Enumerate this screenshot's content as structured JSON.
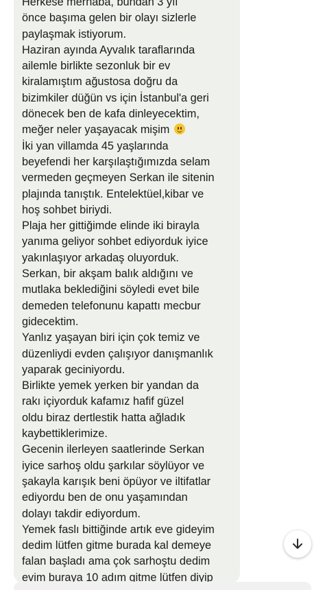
{
  "message": {
    "lines": [
      "Herkese merhaba, bundan 3 yıl",
      "önce başıma gelen bir olayı sizlerle",
      "paylaşmak istiyorum.",
      "Haziran ayında Ayvalık taraflarında",
      "ailemle birlikte sezonluk bir ev",
      "kiralamıştım ağustosa doğru da",
      "bizimkiler düğün vs için İstanbul'a geri",
      "dönecek ben de kafa dinleyecektim,",
      "meğer neler yaşayacak mişim",
      "İki yan villamda 45 yaşlarında",
      "beyefendi her karşılaştığımızda selam",
      "vermeden geçmeyen Serkan ile sitenin",
      "plajında tanıştık. Entelektüel,kibar ve",
      "hoş sohbet biriydi.",
      "Plaja her gittiğimde elinde iki birayla",
      "yanıma geliyor sohbet ediyorduk iyice",
      "yakınlaşıyor arkadaş oluyorduk.",
      "Serkan, bir akşam balık aldığını ve",
      "mutlaka beklediğini söyledi evet bile",
      "demeden telefonunu kapattı mecbur",
      "gidecektim.",
      "Yanlız yaşayan biri için çok temiz ve",
      "düzenliydi evden çalışıyor danışmanlık",
      "yaparak geciniyordu.",
      "Birlikte yemek yerken bir yandan da",
      "rakı içiyorduk kafamız hafif güzel",
      "oldu biraz dertlestik hatta ağladık",
      "kaybettiklerimize.",
      " Gecenin ilerleyen saatlerinde Serkan",
      "iyice sarhoş oldu şarkılar söylüyor ve",
      "şakayla karışık beni öpüyor ve iltifatlar",
      "ediyordu ben de onu yaşamından",
      "dolayı takdir ediyordum.",
      "Yemek faslı bittiğinde artık eve gideyim",
      "dedim lütfen gitme burada kal demeye",
      "falan başladı ama çok sarhoştu dedim",
      "evim  buraya 10 adım gitme lütfen diyip"
    ],
    "emoji_after_line_index": 8,
    "emoji": "slightly-smiling-face-icon"
  },
  "scroll_button": {
    "icon": "arrow-down-icon"
  },
  "colors": {
    "bubble_bg": "#eef1ec",
    "text": "#1b1b1b",
    "page_bg": "#ffffff",
    "emoji_yellow": "#f6c530"
  }
}
